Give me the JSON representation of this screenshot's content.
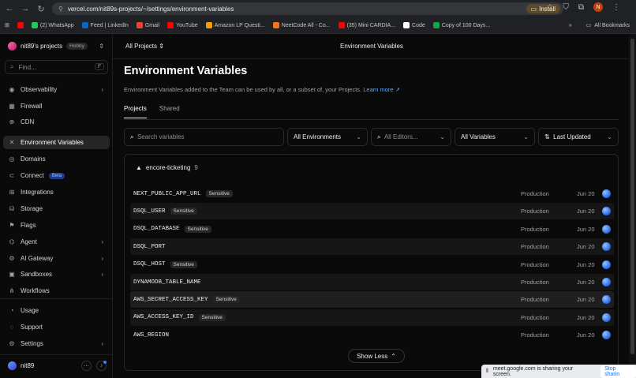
{
  "browser": {
    "url": "vercel.com/nit89s-projects/~/settings/environment-variables",
    "install_label": "Install",
    "profile_initial": "N",
    "bookmarks": [
      "(2) WhatsApp",
      "Feed | LinkedIn",
      "Gmail",
      "YouTube",
      "Amazon LP Questi...",
      "NeetCode All - Co...",
      "(35) Mini CARDIA...",
      "Code",
      "Copy of 100 Days..."
    ],
    "bookmarks_colors": [
      "#22c55e",
      "#0a66c2",
      "#ea4335",
      "#ff0000",
      "#f59e0b",
      "#f97316",
      "#ff0000",
      "#ffffff",
      "#16a34a"
    ],
    "all_bookmarks": "All Bookmarks"
  },
  "sidebar": {
    "team_name": "nit89's projects",
    "plan_badge": "Hobby",
    "find_placeholder": "Find...",
    "find_shortcut": "F",
    "items": [
      {
        "label": "Observability",
        "icon": "eye-icon",
        "glyph": "◉",
        "chevron": true
      },
      {
        "label": "Firewall",
        "icon": "firewall-icon",
        "glyph": "▦",
        "chevron": false
      },
      {
        "label": "CDN",
        "icon": "globe-icon",
        "glyph": "⊕",
        "chevron": false
      },
      {
        "label": "Environment Variables",
        "icon": "variables-icon",
        "glyph": "✕",
        "chevron": false,
        "active": true
      },
      {
        "label": "Domains",
        "icon": "domain-icon",
        "glyph": "◎",
        "chevron": false
      },
      {
        "label": "Connect",
        "icon": "connect-icon",
        "glyph": "⊂",
        "chevron": false,
        "badge": "Beta"
      },
      {
        "label": "Integrations",
        "icon": "integrations-icon",
        "glyph": "⊞",
        "chevron": false
      },
      {
        "label": "Storage",
        "icon": "storage-icon",
        "glyph": "⛁",
        "chevron": false
      },
      {
        "label": "Flags",
        "icon": "flag-icon",
        "glyph": "⚑",
        "chevron": false
      },
      {
        "label": "Agent",
        "icon": "agent-icon",
        "glyph": "⌬",
        "chevron": true
      },
      {
        "label": "AI Gateway",
        "icon": "gateway-icon",
        "glyph": "⚙",
        "chevron": true
      },
      {
        "label": "Sandboxes",
        "icon": "sandbox-icon",
        "glyph": "▣",
        "chevron": true
      },
      {
        "label": "Workflows",
        "icon": "workflow-icon",
        "glyph": "⋔",
        "chevron": false
      },
      {
        "label": "Usage",
        "icon": "usage-icon",
        "glyph": "◔",
        "chevron": false
      },
      {
        "label": "Support",
        "icon": "support-icon",
        "glyph": "◌",
        "chevron": false
      },
      {
        "label": "Settings",
        "icon": "gear-icon",
        "glyph": "⚙",
        "chevron": true
      }
    ],
    "user_name": "nit89"
  },
  "topbar": {
    "project_switcher": "All Projects",
    "page_label": "Environment Variables"
  },
  "page": {
    "title": "Environment Variables",
    "description": "Environment Variables added to the Team can be used by all, or a subset of, your Projects.",
    "learn_more": "Learn more",
    "tabs": [
      "Projects",
      "Shared"
    ]
  },
  "filters": {
    "search_placeholder": "Search variables",
    "environments": "All Environments",
    "editors_placeholder": "All Editors...",
    "variables": "All Variables",
    "sort": "Last Updated"
  },
  "group": {
    "name": "encore-ticketing",
    "count": "9",
    "sensitive_label": "Sensitive",
    "variables": [
      {
        "key": "NEXT_PUBLIC_APP_URL",
        "sensitive": true,
        "environment": "Production",
        "date": "Jun 20"
      },
      {
        "key": "DSQL_USER",
        "sensitive": true,
        "environment": "Production",
        "date": "Jun 20"
      },
      {
        "key": "DSQL_DATABASE",
        "sensitive": true,
        "environment": "Production",
        "date": "Jun 20"
      },
      {
        "key": "DSQL_PORT",
        "sensitive": false,
        "environment": "Production",
        "date": "Jun 20"
      },
      {
        "key": "DSQL_HOST",
        "sensitive": true,
        "environment": "Production",
        "date": "Jun 20"
      },
      {
        "key": "DYNAMODB_TABLE_NAME",
        "sensitive": false,
        "environment": "Production",
        "date": "Jun 20"
      },
      {
        "key": "AWS_SECRET_ACCESS_KEY",
        "sensitive": true,
        "environment": "Production",
        "date": "Jun 20"
      },
      {
        "key": "AWS_ACCESS_KEY_ID",
        "sensitive": true,
        "environment": "Production",
        "date": "Jun 20"
      },
      {
        "key": "AWS_REGION",
        "sensitive": false,
        "environment": "Production",
        "date": "Jun 20"
      }
    ],
    "show_less": "Show Less"
  },
  "share_banner": {
    "text": "meet.google.com is sharing your screen.",
    "stop": "Stop sharin"
  }
}
